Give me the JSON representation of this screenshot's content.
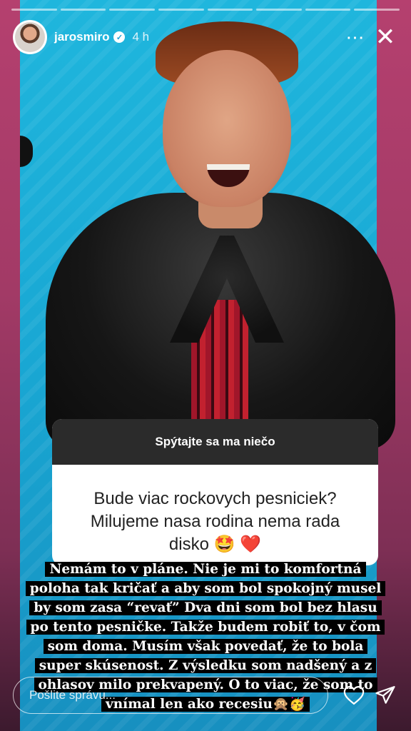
{
  "header": {
    "username": "jarosmiro",
    "verified_mark": "✓",
    "time_ago": "4 h",
    "more_icon": "⋯",
    "close_icon": "✕"
  },
  "progress_segments": 8,
  "question_sticker": {
    "prompt": "Spýtajte sa ma niečo",
    "question": "Bude viac rockovych pesniciek? Milujeme nasa rodina nema rada disko 🤩 ❤️"
  },
  "reply_lines": [
    "Nemám to v pláne. Nie je mi to komfortná",
    "poloha tak kričať a aby som bol spokojný musel",
    "by som zasa “revať” Dva dni som bol bez hlasu",
    "po tento pesničke. Takže budem robiť to, v čom",
    "som doma. Musím však povedať, že to bola",
    "super skúsenost. Z výsledku som nadšený a z",
    "ohlasov milo prekvapený. O to viac, že som to",
    "vnímal len ako recesiu🙊🥳"
  ],
  "footer": {
    "message_placeholder": "Pošlite správu...",
    "like_icon": "heart-icon",
    "share_icon": "send-icon"
  },
  "colors": {
    "background": "#a23a66",
    "photo_bg": "#1fb6dd",
    "sticker_header": "#2b2b2b",
    "text_bg": "#000000"
  }
}
